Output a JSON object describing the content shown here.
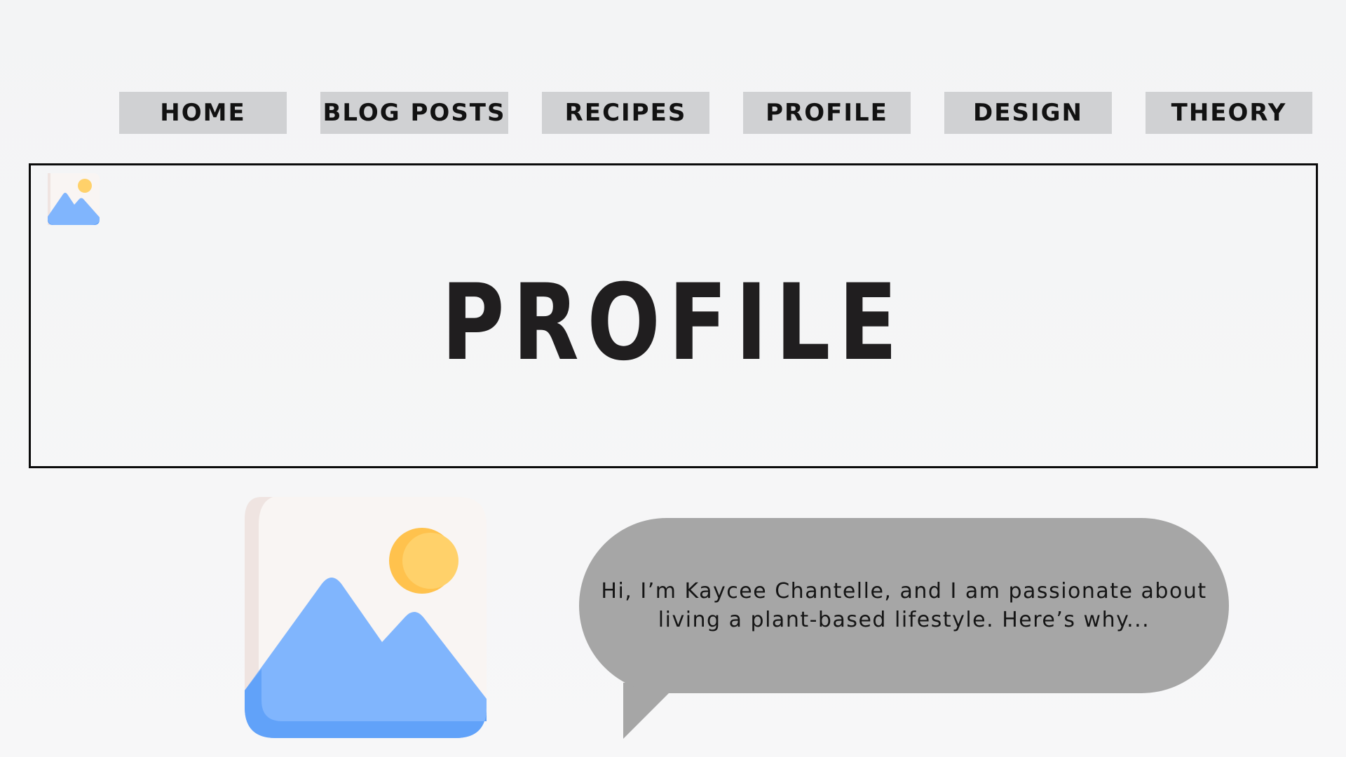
{
  "nav": {
    "items": [
      {
        "id": "home",
        "label": "HOME"
      },
      {
        "id": "blog",
        "label": "BLOG POSTS"
      },
      {
        "id": "recipes",
        "label": "RECIPES"
      },
      {
        "id": "profile",
        "label": "PROFILE"
      },
      {
        "id": "design",
        "label": "DESIGN"
      },
      {
        "id": "theory",
        "label": "THEORY"
      }
    ]
  },
  "hero": {
    "title": "PROFILE",
    "icon": "image-placeholder-icon"
  },
  "profile_image": {
    "icon": "image-placeholder-icon"
  },
  "bubble": {
    "line1": "Hi, I’m Kaycee Chantelle, and I am passionate about",
    "line2": "living a plant-based lifestyle. Here’s why..."
  },
  "colors": {
    "nav_bg": "#d0d1d3",
    "bubble_bg": "#a6a6a6",
    "icon_blue": "#80b5fd",
    "icon_sun": "#ffd16a",
    "text": "#201e1f"
  }
}
